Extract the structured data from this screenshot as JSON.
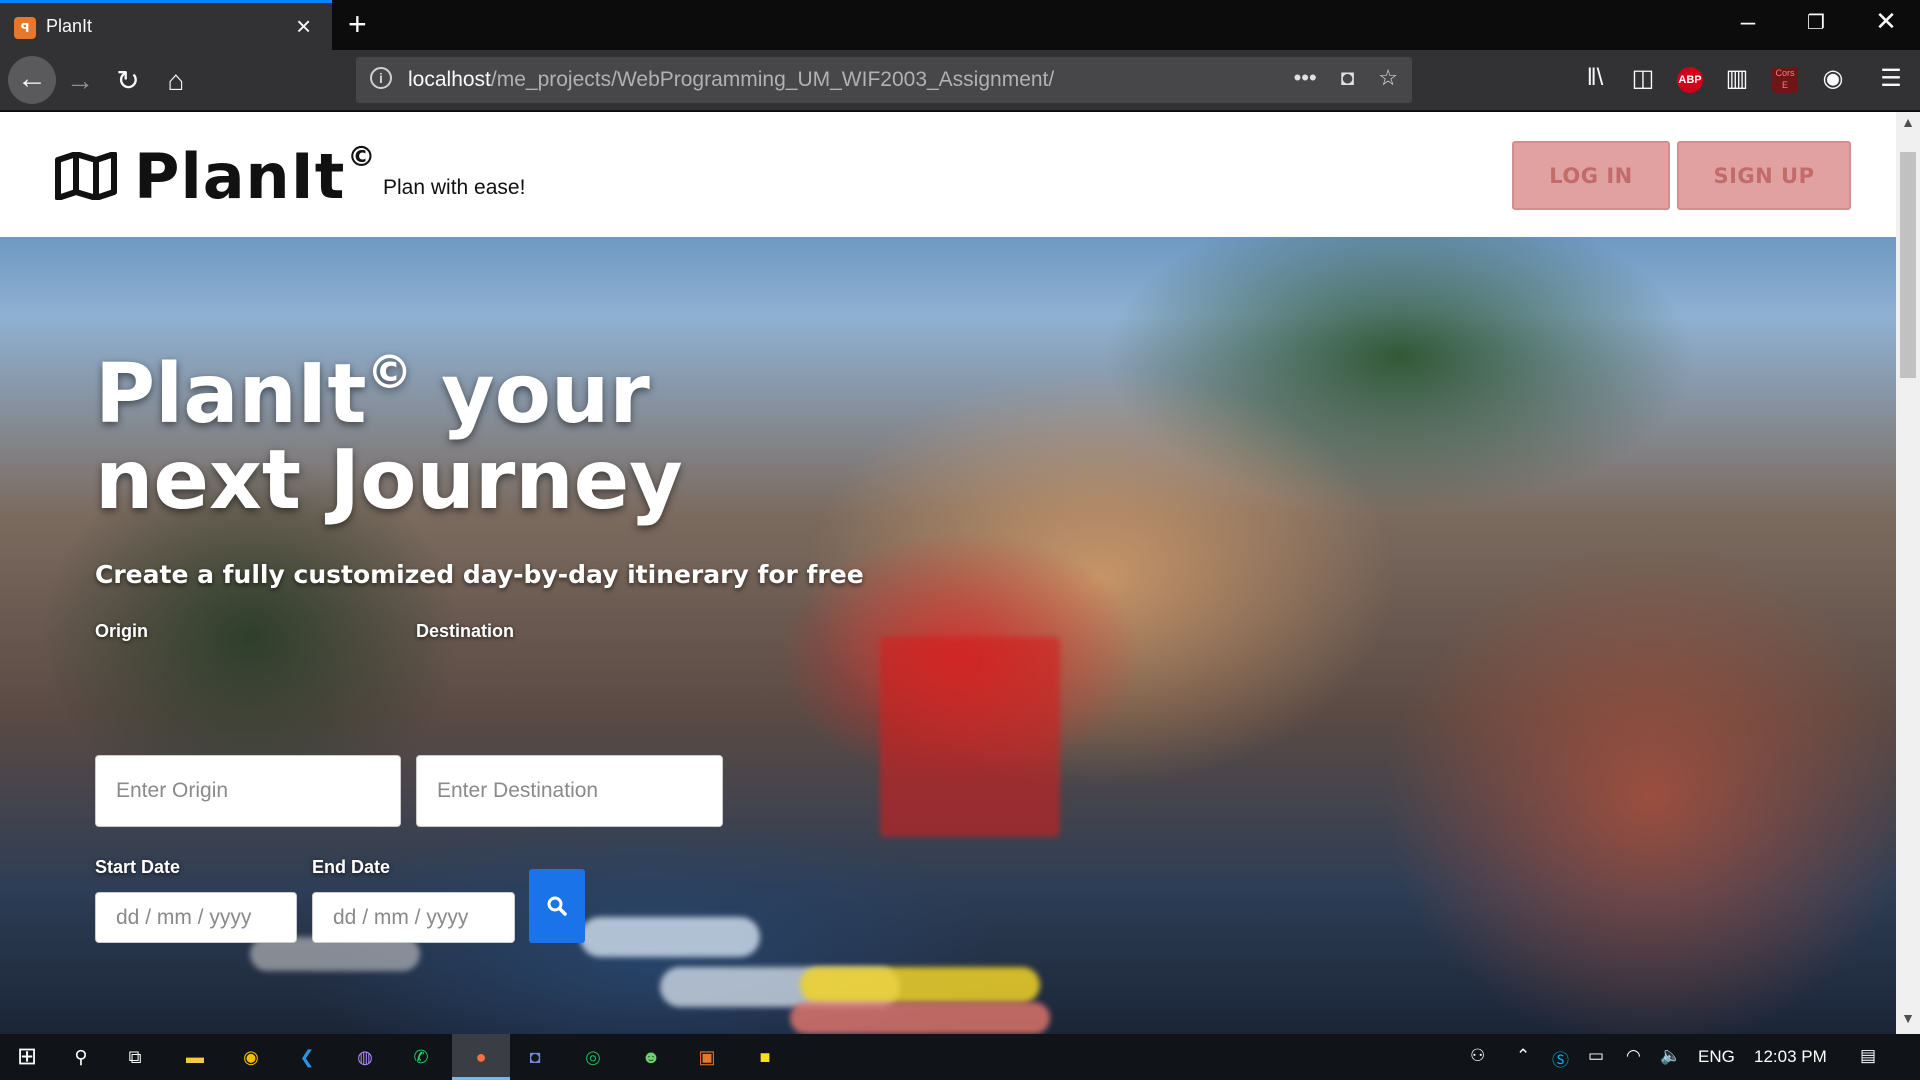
{
  "browser": {
    "tab_title": "PlanIt",
    "tab_favicon": "🗺",
    "url_host": "localhost",
    "url_path": "/me_projects/WebProgramming_UM_WIF2003_Assignment/",
    "toolbar_icons": [
      "library-icon",
      "sidebar-icon",
      "adblock-icon",
      "extension-icon",
      "cors-icon",
      "account-icon",
      "menu-icon"
    ],
    "abp_label": "ABP",
    "cors_label": "Cors E"
  },
  "site": {
    "logo_text": "PlanIt",
    "logo_copyright": "©",
    "tagline": "Plan with ease!",
    "login_label": "LOG IN",
    "signup_label": "SIGN UP"
  },
  "hero": {
    "title_line1": "PlanIt",
    "title_copyright": "©",
    "title_line1_rest": " your",
    "title_line2": "next Journey",
    "subtitle": "Create a fully customized day-by-day itinerary for free",
    "origin_label": "Origin",
    "origin_placeholder": "Enter Origin",
    "destination_label": "Destination",
    "destination_placeholder": "Enter Destination",
    "start_label": "Start Date",
    "start_placeholder": "dd / mm / yyyy",
    "end_label": "End Date",
    "end_placeholder": "dd / mm / yyyy"
  },
  "taskbar": {
    "language": "ENG",
    "time": "12:03 PM"
  },
  "colors": {
    "accent": "#0a84ff",
    "header_button": "#e0a1a0",
    "search_button": "#1a73e8"
  }
}
